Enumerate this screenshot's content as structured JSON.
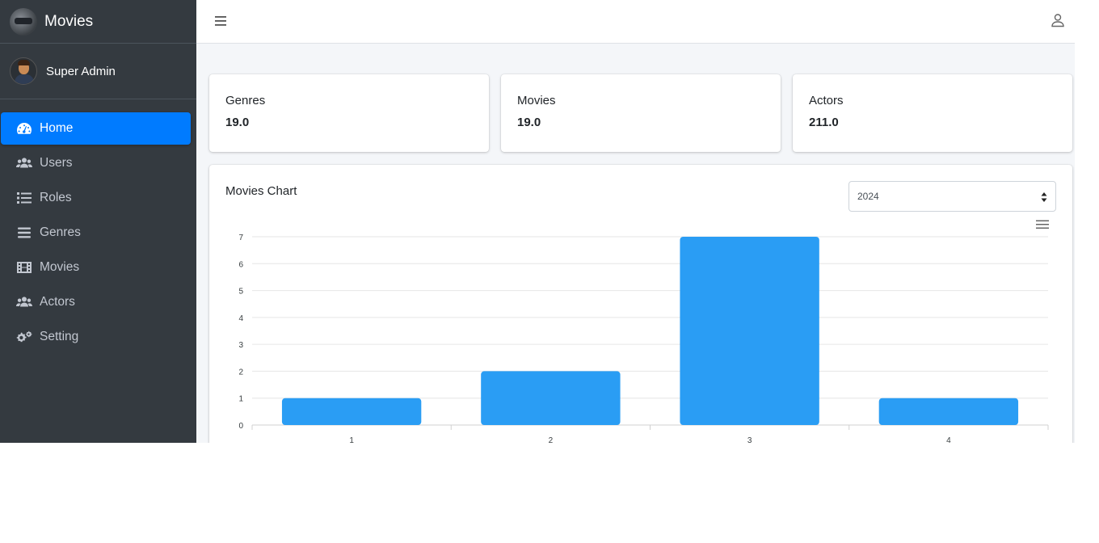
{
  "brand": {
    "title": "Movies"
  },
  "user": {
    "name": "Super Admin"
  },
  "sidebar": {
    "items": [
      {
        "label": "Home",
        "icon": "dashboard-icon",
        "active": true
      },
      {
        "label": "Users",
        "icon": "users-icon"
      },
      {
        "label": "Roles",
        "icon": "list-icon"
      },
      {
        "label": "Genres",
        "icon": "bars-icon"
      },
      {
        "label": "Movies",
        "icon": "film-icon"
      },
      {
        "label": "Actors",
        "icon": "users-icon"
      },
      {
        "label": "Setting",
        "icon": "cogs-icon"
      }
    ]
  },
  "stats": [
    {
      "label": "Genres",
      "value": "19.0"
    },
    {
      "label": "Movies",
      "value": "19.0"
    },
    {
      "label": "Actors",
      "value": "211.0"
    }
  ],
  "chart_panel": {
    "title": "Movies Chart",
    "year_select": {
      "selected": "2024"
    }
  },
  "colors": {
    "sidebar": "#343a40",
    "accent": "#007bff",
    "bar": "#2a9df4"
  },
  "chart_data": {
    "type": "bar",
    "categories": [
      "1",
      "2",
      "3",
      "4"
    ],
    "values": [
      1,
      2,
      7,
      1
    ],
    "ylim": [
      0,
      7
    ],
    "yticks": [
      0,
      1,
      2,
      3,
      4,
      5,
      6,
      7
    ],
    "grid": true
  }
}
